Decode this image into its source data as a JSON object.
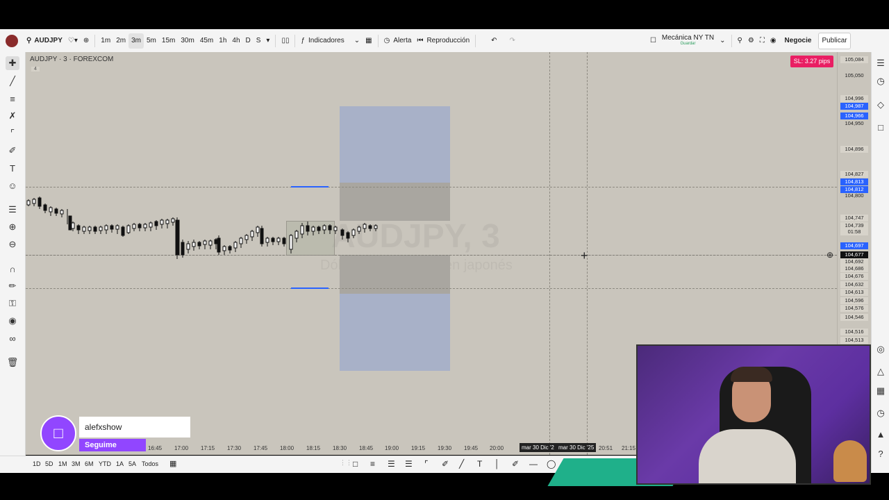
{
  "colors": {
    "chart_bg": "#c9c5bc",
    "toolbar_bg": "#f4f4f4",
    "accent_blue": "#2962ff",
    "sl_badge": "#e91e63",
    "twitch_purple": "#9146ff",
    "teal": "#1fb08a"
  },
  "toolbar": {
    "symbol": "AUDJPY",
    "intervals": [
      "1m",
      "2m",
      "3m",
      "5m",
      "15m",
      "30m",
      "45m",
      "1h",
      "4h",
      "D",
      "S"
    ],
    "active_interval": "3m",
    "indicators_label": "Indicadores",
    "alert_label": "Alerta",
    "replay_label": "Reproducción",
    "layout_name": "Mecánica NY TN",
    "layout_sub": "Guardar",
    "trade_label": "Negocie",
    "publish_label": "Publicar"
  },
  "chart": {
    "legend": "AUDJPY · 3 · FOREXCOM",
    "legend_sub": "4",
    "watermark_symbol": "AUDJPY, 3",
    "watermark_sub": "Dólar australiano / Yen japonés",
    "sl_badge": "SL: 3.27 pips"
  },
  "price_scale": [
    {
      "text": "105,084",
      "style": "box"
    },
    {
      "text": "105,050",
      "style": "plain"
    },
    {
      "text": "104,996",
      "style": "box"
    },
    {
      "text": "104,987",
      "style": "blue"
    },
    {
      "text": "104,966",
      "style": "blue"
    },
    {
      "text": "104,950",
      "style": "plain"
    },
    {
      "text": "104,896",
      "style": "box"
    },
    {
      "text": "104,827",
      "style": "box"
    },
    {
      "text": "104,813",
      "style": "blue"
    },
    {
      "text": "104,812",
      "style": "blue"
    },
    {
      "text": "104,800",
      "style": "plain"
    },
    {
      "text": "104,747",
      "style": "box"
    },
    {
      "text": "104,739",
      "style": "box"
    },
    {
      "text": "01:58",
      "style": "box"
    },
    {
      "text": "104,697",
      "style": "blue"
    },
    {
      "text": "104,677",
      "style": "box"
    },
    {
      "text": "104,692",
      "style": "box"
    },
    {
      "text": "104,686",
      "style": "box"
    },
    {
      "text": "104,676",
      "style": "box"
    },
    {
      "text": "104,632",
      "style": "box"
    },
    {
      "text": "104,613",
      "style": "box"
    },
    {
      "text": "104,596",
      "style": "box"
    },
    {
      "text": "104,576",
      "style": "box"
    },
    {
      "text": "104,546",
      "style": "box"
    },
    {
      "text": "104,516",
      "style": "box"
    },
    {
      "text": "104,513",
      "style": "box"
    }
  ],
  "time_scale": [
    "16:45",
    "17:00",
    "17:15",
    "17:30",
    "17:45",
    "18:00",
    "18:15",
    "18:30",
    "18:45",
    "19:00",
    "19:15",
    "19:30",
    "19:45",
    "20:00",
    "mar 30 Dic '2",
    "mar 30 Dic '25",
    "20:51",
    "21:15"
  ],
  "bottom": {
    "ranges": [
      "1D",
      "5D",
      "1M",
      "3M",
      "6M",
      "YTD",
      "1A",
      "5A",
      "Todos"
    ]
  },
  "overlay": {
    "twitch_name": "alefxshow",
    "twitch_follow": "Seguime"
  }
}
